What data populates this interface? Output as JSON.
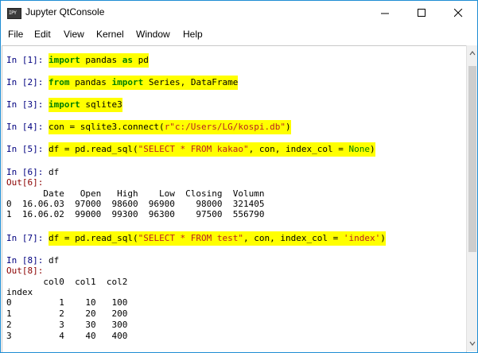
{
  "window": {
    "title": "Jupyter QtConsole",
    "icon_label": "IPY"
  },
  "menu": [
    "File",
    "Edit",
    "View",
    "Kernel",
    "Window",
    "Help"
  ],
  "cells": {
    "c1": {
      "prompt": "In [1]: ",
      "kw1": "import",
      "t1": " pandas ",
      "kw2": "as",
      "t2": " pd"
    },
    "c2": {
      "prompt": "In [2]: ",
      "kw1": "from",
      "t1": " pandas ",
      "kw2": "import",
      "t2": " Series, DataFrame"
    },
    "c3": {
      "prompt": "In [3]: ",
      "kw1": "import",
      "t1": " sqlite3"
    },
    "c4": {
      "prompt": "In [4]: ",
      "t1": "con = sqlite3.connect(",
      "s1": "r\"c:/Users/LG/kospi.db\"",
      "t2": ")"
    },
    "c5": {
      "prompt": "In [5]: ",
      "t1": "df = pd.read_sql(",
      "s1": "\"SELECT * FROM kakao\"",
      "t2": ", con, index_col = ",
      "b1": "None",
      "t3": ")"
    },
    "c6": {
      "prompt": "In [6]: ",
      "t1": "df",
      "out": "Out[6]:"
    },
    "c7": {
      "prompt": "In [7]: ",
      "t1": "df = pd.read_sql(",
      "s1": "\"SELECT * FROM test\"",
      "t2": ", con, index_col = ",
      "s2": "'index'",
      "t3": ")"
    },
    "c8": {
      "prompt": "In [8]: ",
      "t1": "df",
      "out": "Out[8]:"
    }
  },
  "table1": {
    "header": "       Date   Open   High    Low  Closing  Volumn",
    "rows": [
      "0  16.06.03  97000  98600  96900    98000  321405",
      "1  16.06.02  99000  99300  96300    97500  556790"
    ]
  },
  "table2": {
    "header": "       col0  col1  col2",
    "index_label": "index",
    "rows": [
      "0         1    10   100",
      "1         2    20   200",
      "2         3    30   300",
      "3         4    40   400"
    ]
  }
}
